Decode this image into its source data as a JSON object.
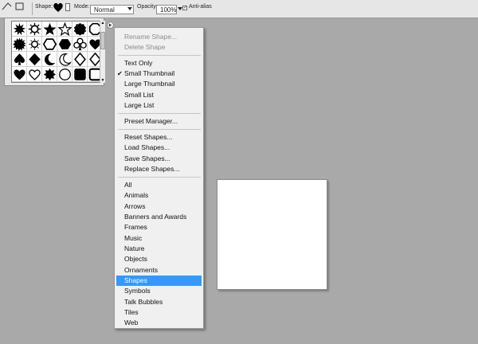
{
  "options_bar": {
    "shape_label": "Shape:",
    "mode_label": "Mode:",
    "mode_value": "Normal",
    "opacity_label": "Opacity:",
    "opacity_value": "100%",
    "antialias_label": "Anti-alias",
    "antialias_checked": true
  },
  "shape_picker": {
    "shapes": [
      "starburst-icon",
      "sun-icon",
      "star-icon",
      "star-outline-icon",
      "seal-icon",
      "octagon-outline-icon",
      "burst-icon",
      "sun-outline-icon",
      "club-icon",
      "hexagon-outline-icon",
      "club-suit-icon",
      "heart-suit-icon",
      "spade-suit-icon",
      "diamond-suit-icon",
      "crescent-icon",
      "crescent-outline-icon",
      "diamond-outline-icon",
      "none",
      "heart-icon",
      "heart-outline-icon",
      "flower-icon",
      "circle-frame-icon",
      "rounded-square-icon",
      "rounded-square-outline-icon"
    ],
    "fill_color": "#000000"
  },
  "menu": {
    "group1": [
      "Rename Shape...",
      "Delete Shape"
    ],
    "group2": [
      "Text Only",
      "Small Thumbnail",
      "Large Thumbnail",
      "Small List",
      "Large List"
    ],
    "checked_item": "Small Thumbnail",
    "group3": [
      "Preset Manager..."
    ],
    "group4": [
      "Reset Shapes...",
      "Load Shapes...",
      "Save Shapes...",
      "Replace Shapes..."
    ],
    "group5": [
      "All",
      "Animals",
      "Arrows",
      "Banners and Awards",
      "Frames",
      "Music",
      "Nature",
      "Objects",
      "Ornaments",
      "Shapes",
      "Symbols",
      "Talk Bubbles",
      "Tiles",
      "Web"
    ],
    "selected_item": "Shapes",
    "highlight_color": "#3399ff"
  },
  "colors": {
    "workspace": "#a9a9a9",
    "menu_bg": "#f0f0f0",
    "document": "#ffffff"
  }
}
